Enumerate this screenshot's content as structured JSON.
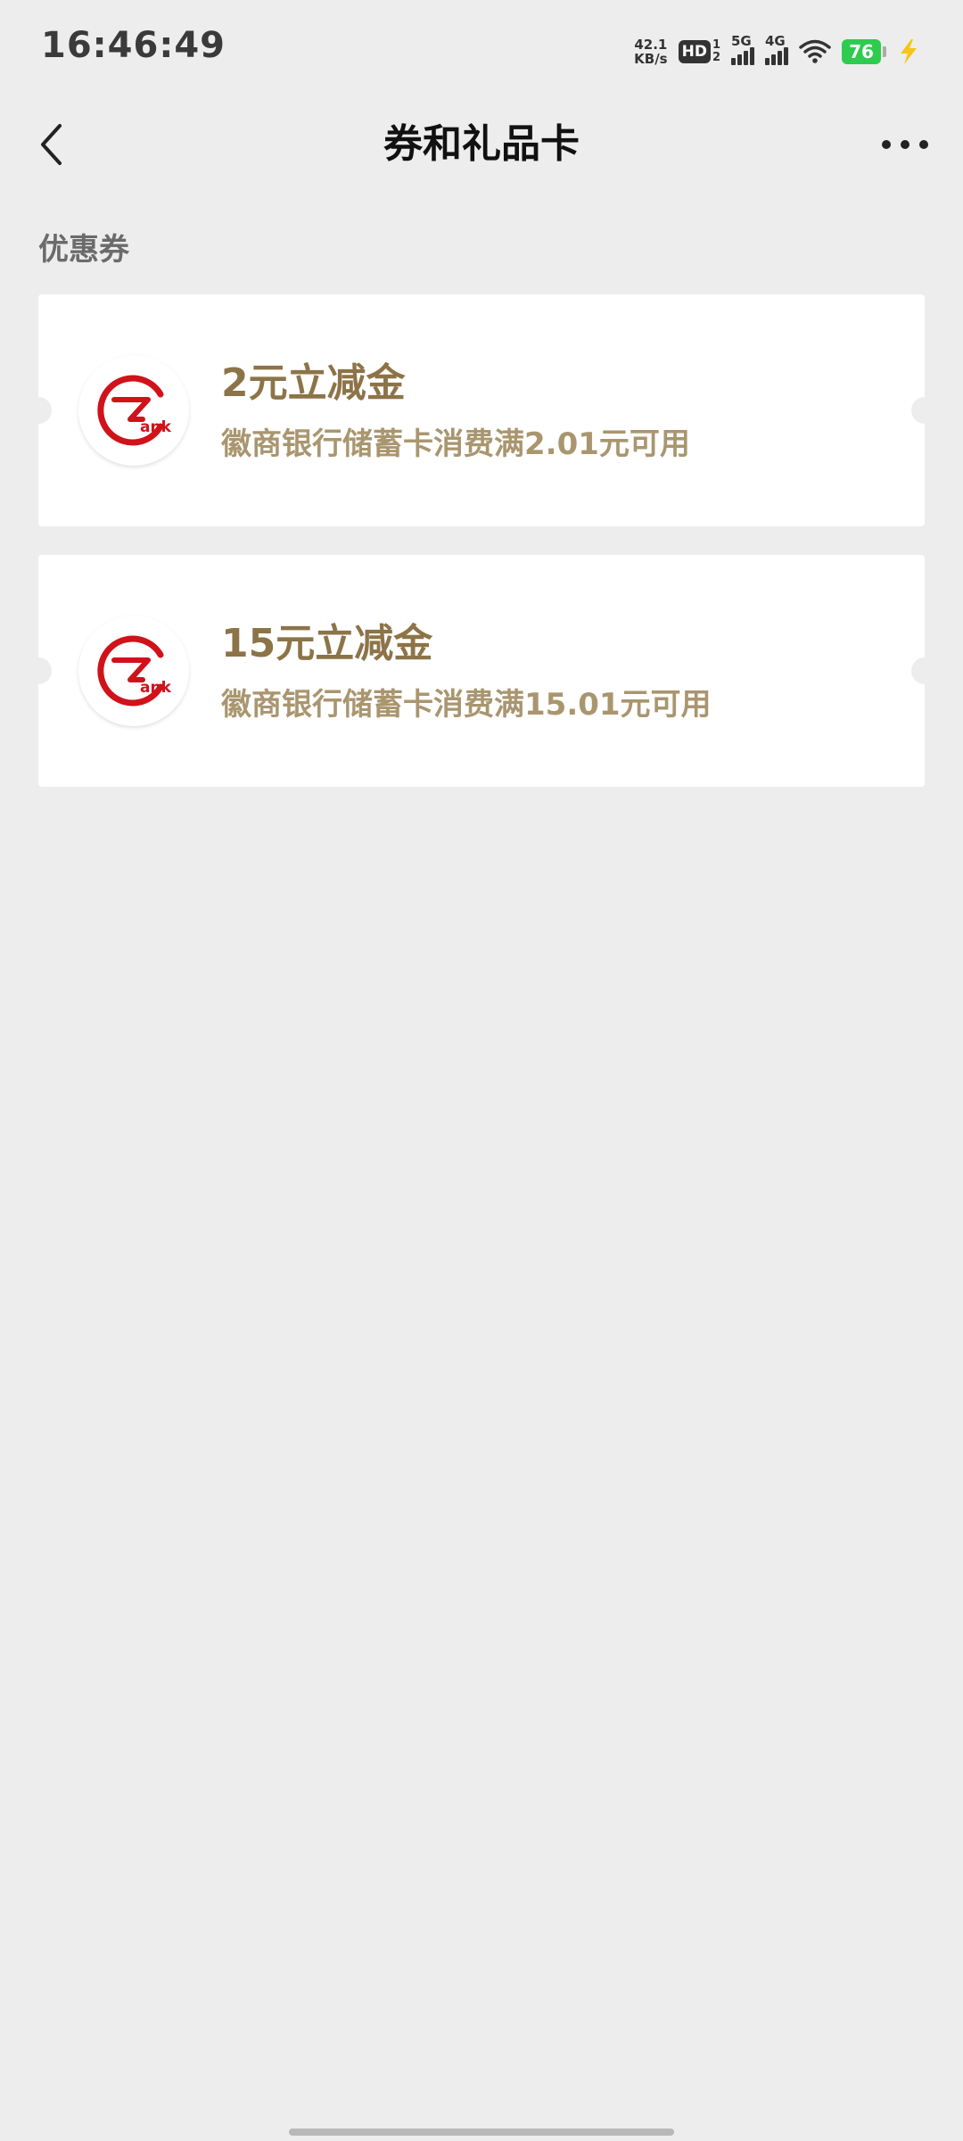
{
  "status_bar": {
    "time": "16:46:49",
    "net_speed_value": "42.1",
    "net_speed_unit": "KB/s",
    "hd_label": "HD",
    "hd_sub_top": "1",
    "hd_sub_bottom": "2",
    "signal_1_label": "5G",
    "signal_2_label": "4G",
    "battery_level": "76",
    "battery_color": "#2ecc4e",
    "charging_icon": "lightning-icon"
  },
  "nav": {
    "back_icon": "chevron-left-icon",
    "title": "券和礼品卡",
    "more_icon": "more-horizontal-icon"
  },
  "section": {
    "label": "优惠券"
  },
  "coupons": [
    {
      "title": "2元立减金",
      "description": "徽商银行储蓄卡消费满2.01元可用",
      "logo": "bank-logo-icon"
    },
    {
      "title": "15元立减金",
      "description": "徽商银行储蓄卡消费满15.01元可用",
      "logo": "bank-logo-icon"
    }
  ],
  "logo_text": "ank",
  "colors": {
    "background": "#ededed",
    "coupon_title": "#8c7448",
    "coupon_desc": "#a9966f",
    "logo_red": "#d0121b"
  }
}
